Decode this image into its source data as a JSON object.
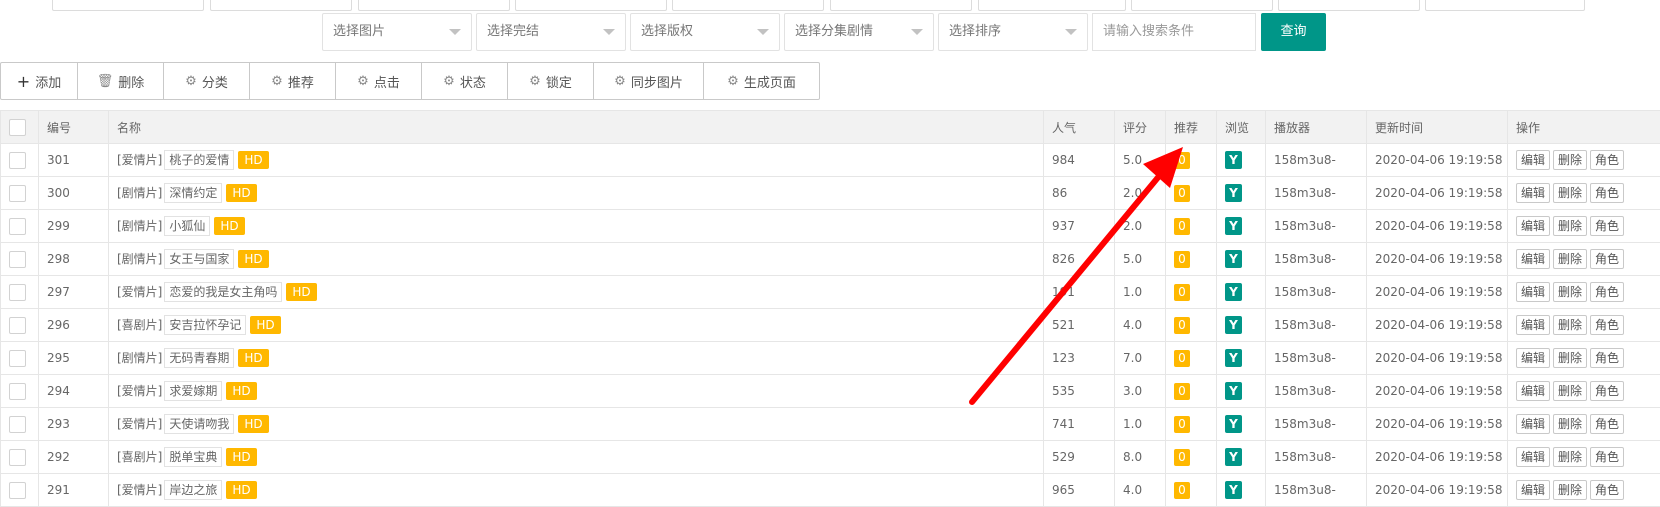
{
  "filters": {
    "image": "选择图片",
    "complete": "选择完结",
    "copyright": "选择版权",
    "episode": "选择分集剧情",
    "sort": "选择排序",
    "search_placeholder": "请输入搜索条件",
    "query_button": "查询"
  },
  "toolbar": {
    "add": "添加",
    "delete": "删除",
    "category": "分类",
    "recommend": "推荐",
    "hits": "点击",
    "status": "状态",
    "lock": "锁定",
    "sync_images": "同步图片",
    "generate_page": "生成页面"
  },
  "table": {
    "headers": {
      "id": "编号",
      "name": "名称",
      "popularity": "人气",
      "score": "评分",
      "recommend": "推荐",
      "browse": "浏览",
      "player": "播放器",
      "update_time": "更新时间",
      "actions": "操作"
    },
    "action_labels": {
      "edit": "编辑",
      "delete": "删除",
      "role": "角色"
    },
    "hd_label": "HD",
    "browse_label": "Y",
    "rows": [
      {
        "id": "301",
        "category": "[爱情片]",
        "name": "桃子的爱情",
        "popularity": "984",
        "score": "5.0",
        "recommend": "0",
        "player": "158m3u8-",
        "time": "2020-04-06 19:19:58"
      },
      {
        "id": "300",
        "category": "[剧情片]",
        "name": "深情约定",
        "popularity": "86",
        "score": "2.0",
        "recommend": "0",
        "player": "158m3u8-",
        "time": "2020-04-06 19:19:58"
      },
      {
        "id": "299",
        "category": "[剧情片]",
        "name": "小狐仙",
        "popularity": "937",
        "score": "2.0",
        "recommend": "0",
        "player": "158m3u8-",
        "time": "2020-04-06 19:19:58"
      },
      {
        "id": "298",
        "category": "[剧情片]",
        "name": "女王与国家",
        "popularity": "826",
        "score": "5.0",
        "recommend": "0",
        "player": "158m3u8-",
        "time": "2020-04-06 19:19:58"
      },
      {
        "id": "297",
        "category": "[爱情片]",
        "name": "恋爱的我是女主角吗",
        "popularity": "191",
        "score": "1.0",
        "recommend": "0",
        "player": "158m3u8-",
        "time": "2020-04-06 19:19:58"
      },
      {
        "id": "296",
        "category": "[喜剧片]",
        "name": "安吉拉怀孕记",
        "popularity": "521",
        "score": "4.0",
        "recommend": "0",
        "player": "158m3u8-",
        "time": "2020-04-06 19:19:58"
      },
      {
        "id": "295",
        "category": "[剧情片]",
        "name": "无码青春期",
        "popularity": "123",
        "score": "7.0",
        "recommend": "0",
        "player": "158m3u8-",
        "time": "2020-04-06 19:19:58"
      },
      {
        "id": "294",
        "category": "[爱情片]",
        "name": "求爱嫁期",
        "popularity": "535",
        "score": "3.0",
        "recommend": "0",
        "player": "158m3u8-",
        "time": "2020-04-06 19:19:58"
      },
      {
        "id": "293",
        "category": "[爱情片]",
        "name": "天使请吻我",
        "popularity": "741",
        "score": "1.0",
        "recommend": "0",
        "player": "158m3u8-",
        "time": "2020-04-06 19:19:58"
      },
      {
        "id": "292",
        "category": "[喜剧片]",
        "name": "脱单宝典",
        "popularity": "529",
        "score": "8.0",
        "recommend": "0",
        "player": "158m3u8-",
        "time": "2020-04-06 19:19:58"
      },
      {
        "id": "291",
        "category": "[爱情片]",
        "name": "岸边之旅",
        "popularity": "965",
        "score": "4.0",
        "recommend": "0",
        "player": "158m3u8-",
        "time": "2020-04-06 19:19:58"
      }
    ]
  },
  "colors": {
    "accent_teal": "#009688",
    "badge_yellow": "#ffb800",
    "time_red": "#ff0000",
    "arrow_red": "#ff0000"
  }
}
